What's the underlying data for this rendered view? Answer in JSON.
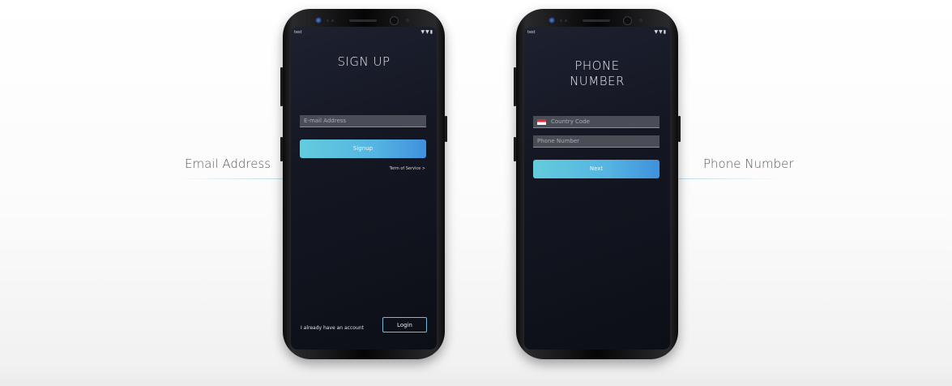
{
  "left_label": "Email Address",
  "right_label": "Phone Number",
  "colors": {
    "accent_gradient_start": "#63ccdc",
    "accent_gradient_end": "#3f91dc",
    "screen_background": "#141622",
    "label_line": "#b9d9ea",
    "flag_red": "#e8273a"
  },
  "status_bar": {
    "time": "test",
    "icons": "wifi-icon signal-icon battery-icon",
    "icons_text": "▼▼▮"
  },
  "signup_screen": {
    "title": "SIGN UP",
    "email_placeholder": "E-mail Address",
    "signup_button": "Signup",
    "terms_link": "Term of Service >",
    "already_text": "I already have an account",
    "login_button": "Login"
  },
  "phone_screen": {
    "title_line1": "PHONE",
    "title_line2": "NUMBER",
    "flag_icon": "singapore-flag-icon",
    "country_code_placeholder": "Country Code",
    "phone_placeholder": "Phone Number",
    "next_button": "Next"
  }
}
